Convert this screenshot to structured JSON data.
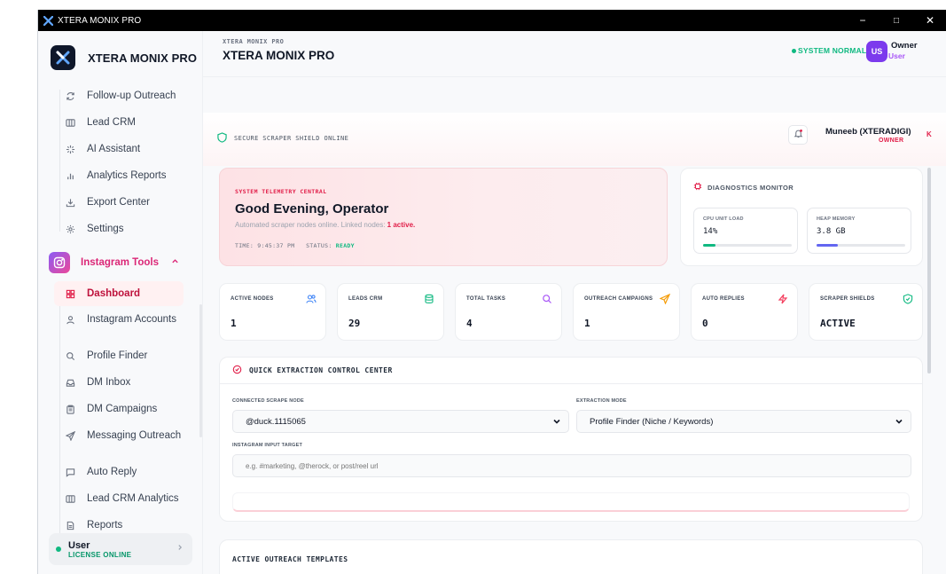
{
  "window": {
    "title": "XTERA MONIX PRO",
    "controls": [
      "−",
      "□",
      "✕"
    ]
  },
  "sidebar": {
    "brand": "XTERA MONIX PRO",
    "items_top": [
      {
        "label": "Follow-up Outreach",
        "icon": "refresh-icon"
      },
      {
        "label": "Lead CRM",
        "icon": "columns-icon"
      },
      {
        "label": "AI Assistant",
        "icon": "sparkle-icon"
      },
      {
        "label": "Analytics Reports",
        "icon": "bar-chart-icon"
      },
      {
        "label": "Export Center",
        "icon": "download-icon"
      },
      {
        "label": "Settings",
        "icon": "gear-icon"
      }
    ],
    "section": {
      "label": "Instagram Tools",
      "icon": "instagram-icon"
    },
    "items_ig": [
      {
        "label": "Dashboard",
        "icon": "grid-icon",
        "active": true
      },
      {
        "label": "Instagram Accounts",
        "icon": "user-icon"
      },
      {
        "label": "Profile Finder",
        "icon": "search-icon"
      },
      {
        "label": "DM Inbox",
        "icon": "inbox-icon"
      },
      {
        "label": "DM Campaigns",
        "icon": "clipboard-icon"
      },
      {
        "label": "Messaging Outreach",
        "icon": "send-icon"
      },
      {
        "label": "Auto Reply",
        "icon": "message-icon"
      },
      {
        "label": "Lead CRM Analytics",
        "icon": "columns-icon"
      },
      {
        "label": "Reports",
        "icon": "file-icon"
      }
    ],
    "user": {
      "name": "User",
      "license": "LICENSE ONLINE"
    }
  },
  "header": {
    "subtitle": "XTERA MONIX PRO",
    "title": "XTERA MONIX PRO",
    "status": "SYSTEM NORMAL",
    "avatar": "US",
    "role": "Owner",
    "role_sub": "User"
  },
  "shield": {
    "text": "SECURE SCRAPER SHIELD ONLINE",
    "operator_name": "Muneeb (XTERADIGI)",
    "operator_role": "OWNER",
    "operator_initial": "K"
  },
  "hero": {
    "tag": "SYSTEM TELEMETRY CENTRAL",
    "title": "Good Evening, Operator",
    "desc_prefix": "Automated scraper nodes online. Linked nodes: ",
    "desc_highlight": "1 active.",
    "time_label": "TIME: 9:45:37 PM",
    "status_label": "STATUS:",
    "status_value": "READY"
  },
  "diagnostics": {
    "title": "DIAGNOSTICS MONITOR",
    "cpu": {
      "label": "CPU UNIT LOAD",
      "value": "14%",
      "fraction": 0.14,
      "color": "#10b981"
    },
    "heap": {
      "label": "HEAP MEMORY",
      "value": "3.8 GB",
      "fraction": 0.24,
      "color": "#6366f1"
    }
  },
  "stats": [
    {
      "label": "ACTIVE NODES",
      "value": "1",
      "icon": "users-icon",
      "color": "#3b82f6"
    },
    {
      "label": "LEADS CRM",
      "value": "29",
      "icon": "database-icon",
      "color": "#10b981"
    },
    {
      "label": "TOTAL TASKS",
      "value": "4",
      "icon": "search-icon",
      "color": "#a855f7"
    },
    {
      "label": "OUTREACH CAMPAIGNS",
      "value": "1",
      "icon": "send-icon",
      "color": "#f59e0b"
    },
    {
      "label": "AUTO REPLIES",
      "value": "0",
      "icon": "lightning-icon",
      "color": "#f43f5e"
    },
    {
      "label": "SCRAPER SHIELDS",
      "value": "ACTIVE",
      "icon": "shield-check-icon",
      "color": "#10b981"
    }
  ],
  "quick_extraction": {
    "title": "QUICK EXTRACTION CONTROL CENTER",
    "node_label": "CONNECTED SCRAPE NODE",
    "node_value": "@duck.1115065",
    "mode_label": "EXTRACTION MODE",
    "mode_value": "Profile Finder (Niche / Keywords)",
    "target_label": "INSTAGRAM INPUT TARGET",
    "target_placeholder": "e.g. #marketing, @therock, or post/reel url"
  },
  "templates": {
    "title": "ACTIVE OUTREACH TEMPLATES"
  }
}
